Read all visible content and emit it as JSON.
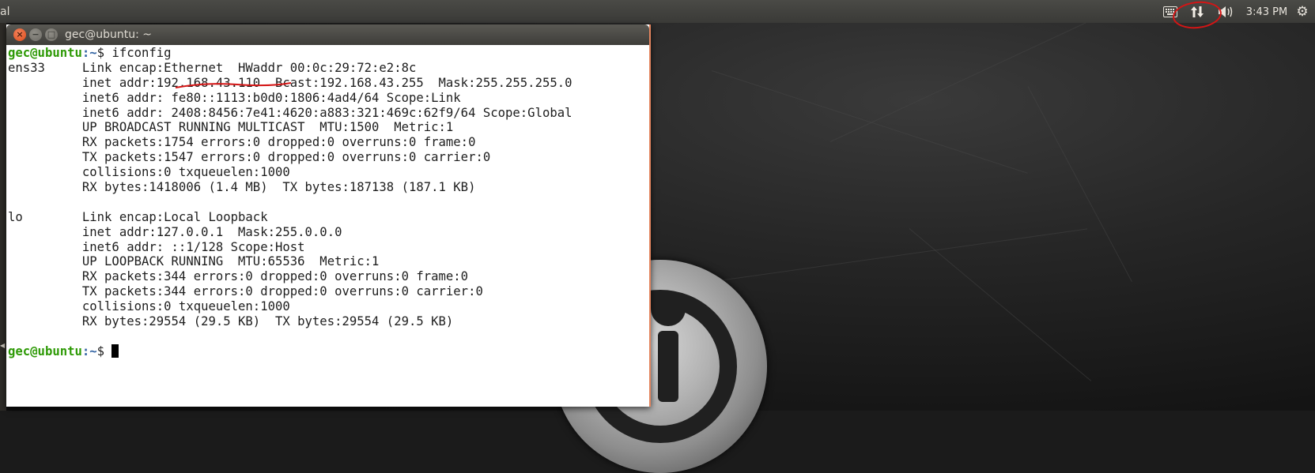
{
  "panel": {
    "app_title": "al",
    "clock": "3:43 PM",
    "keyboard_icon": "keyboard-icon",
    "network_icon": "network-updown-icon",
    "volume_icon": "volume-icon",
    "settings_icon": "gear-icon"
  },
  "terminal": {
    "window_title": "gec@ubuntu: ~",
    "prompt_user": "gec@ubuntu",
    "prompt_path": ":~",
    "prompt_sym": "$ ",
    "command": "ifconfig",
    "output_lines": [
      "ens33     Link encap:Ethernet  HWaddr 00:0c:29:72:e2:8c",
      "          inet addr:192.168.43.110  Bcast:192.168.43.255  Mask:255.255.255.0",
      "          inet6 addr: fe80::1113:b0d0:1806:4ad4/64 Scope:Link",
      "          inet6 addr: 2408:8456:7e41:4620:a883:321:469c:62f9/64 Scope:Global",
      "          UP BROADCAST RUNNING MULTICAST  MTU:1500  Metric:1",
      "          RX packets:1754 errors:0 dropped:0 overruns:0 frame:0",
      "          TX packets:1547 errors:0 dropped:0 overruns:0 carrier:0",
      "          collisions:0 txqueuelen:1000",
      "          RX bytes:1418006 (1.4 MB)  TX bytes:187138 (187.1 KB)",
      "",
      "lo        Link encap:Local Loopback",
      "          inet addr:127.0.0.1  Mask:255.0.0.0",
      "          inet6 addr: ::1/128 Scope:Host",
      "          UP LOOPBACK RUNNING  MTU:65536  Metric:1",
      "          RX packets:344 errors:0 dropped:0 overruns:0 frame:0",
      "          TX packets:344 errors:0 dropped:0 overruns:0 carrier:0",
      "          collisions:0 txqueuelen:1000",
      "          RX bytes:29554 (29.5 KB)  TX bytes:29554 (29.5 KB)",
      ""
    ]
  },
  "colors": {
    "prompt_user": "#2e9a06",
    "prompt_path": "#3465a4",
    "annotation": "#d41515",
    "close_button": "#dc4b1a"
  }
}
